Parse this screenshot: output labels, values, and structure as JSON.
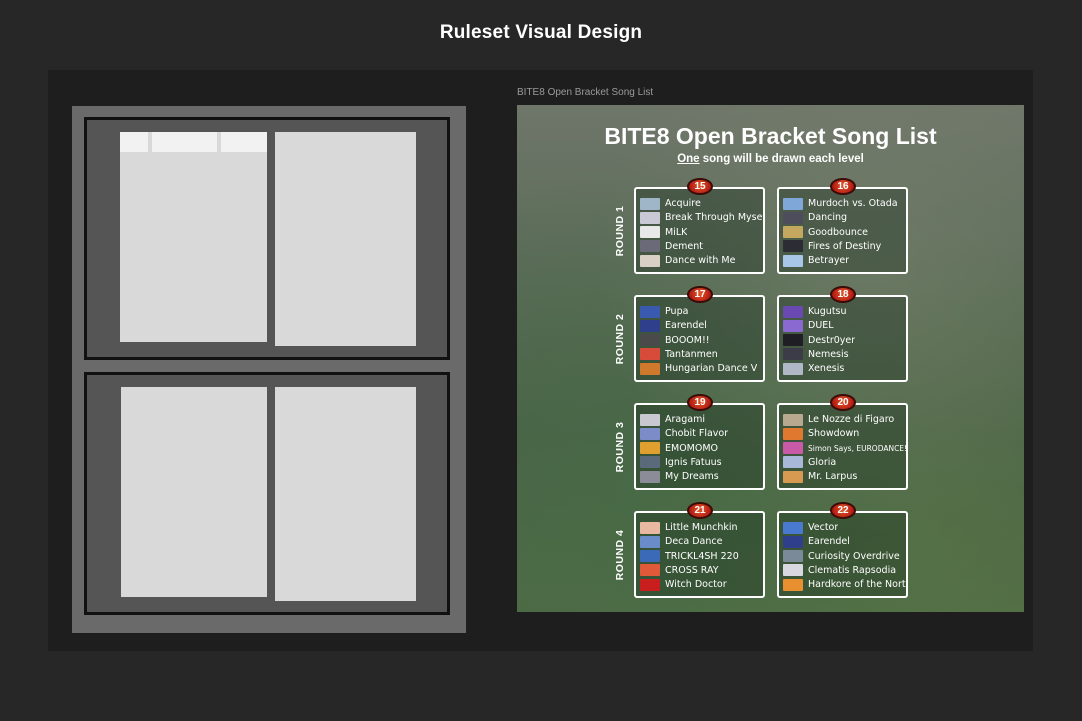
{
  "page_title": "Ruleset Visual Design",
  "artboard": {
    "label": "BITE8 Open Bracket Song List",
    "title": "BITE8 Open Bracket Song List",
    "subtitle_emphasis": "One",
    "subtitle_rest": " song will be drawn each level"
  },
  "rounds": [
    {
      "label": "ROUND 1",
      "levels": [
        {
          "level": "15",
          "songs": [
            {
              "title": "Acquire",
              "thumb": "#9fb5c8"
            },
            {
              "title": "Break Through Myself",
              "thumb": "#c9c9d6"
            },
            {
              "title": "MiLK",
              "thumb": "#e8e8e8"
            },
            {
              "title": "Dement",
              "thumb": "#6a6a78"
            },
            {
              "title": "Dance with Me",
              "thumb": "#d8d0c4"
            }
          ]
        },
        {
          "level": "16",
          "songs": [
            {
              "title": "Murdoch vs. Otada",
              "thumb": "#7fa7d8"
            },
            {
              "title": "Dancing",
              "thumb": "#4d4d5c"
            },
            {
              "title": "Goodbounce",
              "thumb": "#c4a860"
            },
            {
              "title": "Fires of Destiny",
              "thumb": "#2c2c34"
            },
            {
              "title": "Betrayer",
              "thumb": "#a8c6e8"
            }
          ]
        }
      ]
    },
    {
      "label": "ROUND 2",
      "levels": [
        {
          "level": "17",
          "songs": [
            {
              "title": "Pupa",
              "thumb": "#3a5ab0"
            },
            {
              "title": "Earendel",
              "thumb": "#2f3f8c"
            },
            {
              "title": "BOOOM!!",
              "thumb": "#4a4a4a"
            },
            {
              "title": "Tantanmen",
              "thumb": "#d84a3a"
            },
            {
              "title": "Hungarian Dance V",
              "thumb": "#d0782c"
            }
          ]
        },
        {
          "level": "18",
          "songs": [
            {
              "title": "Kugutsu",
              "thumb": "#6a4ab0"
            },
            {
              "title": "DUEL",
              "thumb": "#8a6ad0"
            },
            {
              "title": "Destr0yer",
              "thumb": "#1e1e24"
            },
            {
              "title": "Nemesis",
              "thumb": "#3c3c48"
            },
            {
              "title": "Xenesis",
              "thumb": "#b0b8c8"
            }
          ]
        }
      ]
    },
    {
      "label": "ROUND 3",
      "levels": [
        {
          "level": "19",
          "songs": [
            {
              "title": "Aragami",
              "thumb": "#c8c8d0"
            },
            {
              "title": "Chobit Flavor",
              "thumb": "#7c8cc8"
            },
            {
              "title": "EMOMOMO",
              "thumb": "#e0a030"
            },
            {
              "title": "Ignis Fatuus",
              "thumb": "#5a6a7a"
            },
            {
              "title": "My Dreams",
              "thumb": "#8c8c98"
            }
          ]
        },
        {
          "level": "20",
          "songs": [
            {
              "title": "Le Nozze di Figaro",
              "thumb": "#b8a890"
            },
            {
              "title": "Showdown",
              "thumb": "#e07830"
            },
            {
              "title": "Simon Says, EURODANCE!!",
              "thumb": "#c85aa8"
            },
            {
              "title": "Gloria",
              "thumb": "#a8b8d8"
            },
            {
              "title": "Mr. Larpus",
              "thumb": "#d89a50"
            }
          ]
        }
      ]
    },
    {
      "label": "ROUND 4",
      "levels": [
        {
          "level": "21",
          "songs": [
            {
              "title": "Little Munchkin",
              "thumb": "#e8b8a0"
            },
            {
              "title": "Deca Dance",
              "thumb": "#6a8cc8"
            },
            {
              "title": "TRICKL4SH 220",
              "thumb": "#3a6ab8"
            },
            {
              "title": "CROSS RAY",
              "thumb": "#e05a3a"
            },
            {
              "title": "Witch Doctor",
              "thumb": "#c81e1e"
            }
          ]
        },
        {
          "level": "22",
          "songs": [
            {
              "title": "Vector",
              "thumb": "#4a7ad0"
            },
            {
              "title": "Earendel",
              "thumb": "#2f3f8c"
            },
            {
              "title": "Curiosity Overdrive",
              "thumb": "#7a8a98"
            },
            {
              "title": "Clematis Rapsodia",
              "thumb": "#d8d8e0"
            },
            {
              "title": "Hardkore of the North",
              "thumb": "#e89030"
            }
          ]
        }
      ]
    }
  ]
}
